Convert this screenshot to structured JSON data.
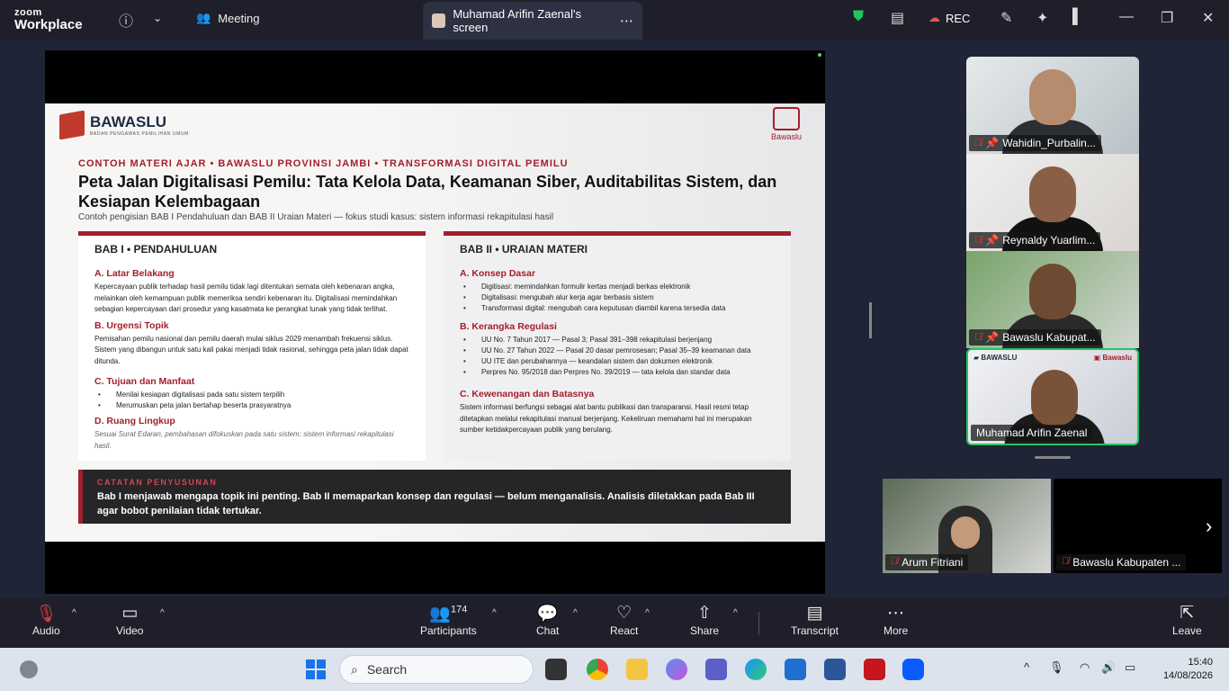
{
  "app": {
    "brand_top": "zoom",
    "brand_bottom": "Workplace"
  },
  "topbar": {
    "meeting_label": "Meeting",
    "screen_tab": "Muhamad Arifin Zaenal's screen",
    "rec": "REC"
  },
  "slide": {
    "logo_name": "BAWASLU",
    "logo_sub": "BADAN PENGAWAS PEMILIHAN UMUM",
    "logo_right": "Bawaslu",
    "kicker": "CONTOH MATERI AJAR  •  BAWASLU PROVINSI JAMBI  •  TRANSFORMASI DIGITAL PEMILU",
    "title": "Peta Jalan Digitalisasi Pemilu: Tata Kelola Data, Keamanan Siber, Auditabilitas Sistem, dan Kesiapan Kelembagaan",
    "subtitle": "Contoh pengisian BAB I Pendahuluan dan BAB II Uraian Materi  —  fokus studi kasus: sistem informasi rekapitulasi hasil",
    "left": {
      "header": "BAB I  •  PENDAHULUAN",
      "a_title": "A. Latar Belakang",
      "a_text": "Kepercayaan publik terhadap hasil pemilu tidak lagi ditentukan semata oleh kebenaran angka, melainkan oleh kemampuan publik memeriksa sendiri kebenaran itu. Digitalisasi memindahkan sebagian kepercayaan dari prosedur yang kasatmata ke perangkat lunak yang tidak terlihat.",
      "b_title": "B. Urgensi Topik",
      "b_text": "Pemisahan pemilu nasional dan pemilu daerah mulai siklus 2029 menambah frekuensi siklus. Sistem yang dibangun untuk satu kali pakai menjadi tidak rasional, sehingga peta jalan tidak dapat ditunda.",
      "c_title": "C. Tujuan dan Manfaat",
      "c_items": [
        "Menilai kesiapan digitalisasi pada satu sistem terpilih",
        "Merumuskan peta jalan bertahap beserta prasyaratnya"
      ],
      "d_title": "D. Ruang Lingkup",
      "d_text": "Sesuai Surat Edaran, pembahasan difokuskan pada satu sistem: sistem informasi rekapitulasi hasil."
    },
    "right": {
      "header": "BAB II  •  URAIAN MATERI",
      "a_title": "A. Konsep Dasar",
      "a_items": [
        "Digitisasi: memindahkan formulir kertas menjadi berkas elektronik",
        "Digitalisasi: mengubah alur kerja agar berbasis sistem",
        "Transformasi digital: mengubah cara keputusan diambil karena tersedia data"
      ],
      "b_title": "B. Kerangka Regulasi",
      "b_items": [
        "UU No. 7 Tahun 2017 — Pasal 3; Pasal 391–398 rekapitulasi berjenjang",
        "UU No. 27 Tahun 2022 — Pasal 20 dasar pemrosesan; Pasal 35–39 keamanan data",
        "UU ITE dan perubahannya — keandalan sistem dan dokumen elektronik",
        "Perpres No. 95/2018 dan Perpres No. 39/2019 — tata kelola dan standar data"
      ],
      "c_title": "C. Kewenangan dan Batasnya",
      "c_text": "Sistem informasi berfungsi sebagai alat bantu publikasi dan transparansi. Hasil resmi tetap ditetapkan melalui rekapitulasi manual berjenjang. Kekeliruan memahami hal ini merupakan sumber ketidakpercayaan publik yang berulang."
    },
    "note": {
      "header": "CATATAN PENYUSUNAN",
      "text": "Bab I menjawab mengapa topik ini penting. Bab II memaparkan konsep dan regulasi — belum menganalisis. Analisis diletakkan pada Bab III agar bobot penilaian tidak tertukar."
    }
  },
  "participants_gallery": [
    {
      "name": "Wahidin_Purbalin..."
    },
    {
      "name": "Reynaldy Yuarlim..."
    },
    {
      "name": "Bawaslu Kabupat..."
    },
    {
      "name": "Muhamad Arifin Zaenal"
    }
  ],
  "bottom_tiles": [
    {
      "name": "Arum Fitriani"
    },
    {
      "name": "Bawaslu Kabupaten ..."
    }
  ],
  "toolbar": {
    "audio": "Audio",
    "video": "Video",
    "participants": "Participants",
    "participants_count": "174",
    "chat": "Chat",
    "react": "React",
    "share": "Share",
    "transcript": "Transcript",
    "more": "More",
    "leave": "Leave"
  },
  "taskbar": {
    "search_placeholder": "Search",
    "time": "15:40",
    "date": "14/08/2026"
  },
  "colors": {
    "accent_red": "#a21f2a",
    "speaker_green": "#22c55e"
  }
}
